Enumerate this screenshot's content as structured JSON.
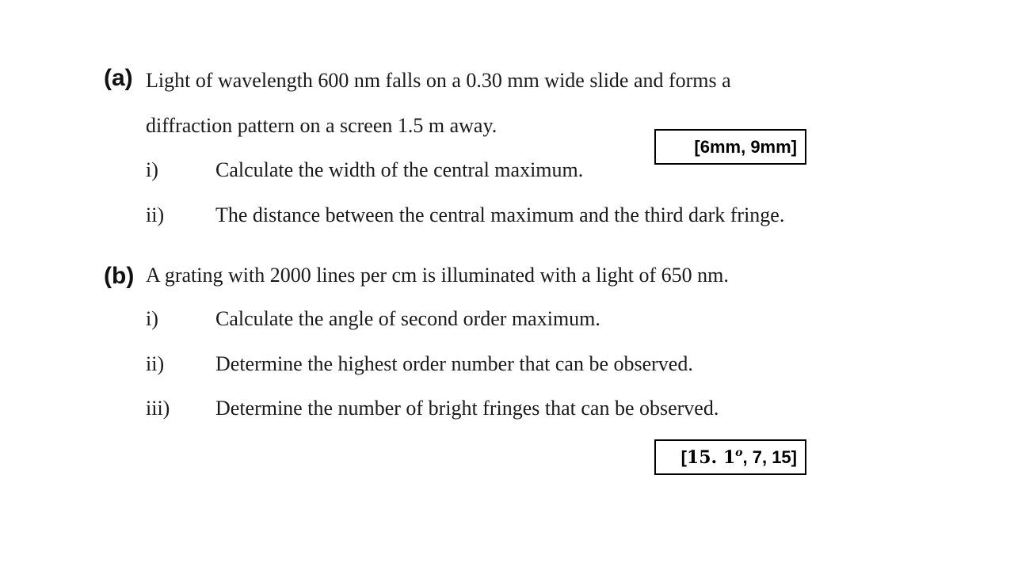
{
  "part_a": {
    "label": "(a)",
    "intro_line1": "Light of wavelength 600 nm falls on a 0.30 mm wide slide and forms a",
    "intro_line2": "diffraction pattern on a screen 1.5 m away.",
    "items": [
      {
        "num": "i)",
        "text": "Calculate the width of the central maximum."
      },
      {
        "num": "ii)",
        "text": "The distance between the central maximum and the third dark fringe."
      }
    ],
    "answer": "[6mm, 9mm]"
  },
  "part_b": {
    "label": "(b)",
    "intro": "A grating with 2000 lines per cm is illuminated with a light of 650 nm.",
    "items": [
      {
        "num": "i)",
        "text": "Calculate the angle of second order maximum."
      },
      {
        "num": "ii)",
        "text": "Determine the highest order number that can be observed."
      },
      {
        "num": "iii)",
        "text": "Determine the number of bright fringes that can be observed."
      }
    ],
    "answer": {
      "open": "[",
      "angle": "15. 1",
      "angle_superscript": "o",
      "rest": ", 7, 15]"
    }
  }
}
